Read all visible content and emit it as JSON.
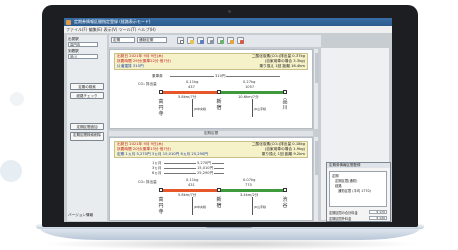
{
  "titlebar": {
    "title": "定期券情報区間指定登録 (経路表示モード)"
  },
  "menubar": {
    "text": "ファイル(F)  編集(E)  表示(V)  ツール(T)  ヘルプ(H)"
  },
  "left_panel": {
    "label1": "出発駅",
    "field1": "高円寺",
    "label2": "到着駅",
    "field2": "品川",
    "button1": "定期の検索",
    "button2": "経路チェック",
    "button3": "定期区間追加",
    "button4": "定期区間検索削除",
    "footer": "バージョン情報"
  },
  "toolbar": {
    "select1": "定期",
    "select2": "通勤定期"
  },
  "upper": {
    "line1_left": "出発日   2021年 9月 9日(木)",
    "line1_right": "二酸化炭素(CO₂)排出量  0.37kg",
    "line2_left": "所要時間 29分(乗車22分 他7分)",
    "line2_right": "(自家用車の場合 3.3kg)",
    "line3_left": "片道運賃 310円",
    "line3_right": "乗り換え 1回  距離 16.4km",
    "fare_label": "乗車券",
    "fare_value": "310円",
    "co2_label": "CO₂ 排出量",
    "co2_a_top": "0.11kg",
    "co2_a_bottom": "437",
    "co2_b_top": "0.27kg",
    "co2_b_bottom": "1057",
    "seg1_label": "5.8km/7分",
    "seg2_label": "10.6km/7分",
    "stations": [
      "高円寺",
      "新宿",
      "品川"
    ],
    "lines": [
      "JR中央線",
      "JR山手線"
    ]
  },
  "separator_label": "定期区間",
  "lower": {
    "line1_left": "出発日   2021年 9月 9日(木)",
    "line1_right": "二酸化炭素(CO₂)排出量  0.18kg",
    "line2_left": "所要時間 20分(乗車13分 他7分)",
    "line2_right": "(自家用車の場合 1.9kg)",
    "line3_left": "定期 1ヵ月 5,270円  3ヵ月 15,010円  6ヵ月 25,290円",
    "line3_right": "乗り換え 1回  距離 9.2km",
    "periods": [
      {
        "label": "1ヵ月",
        "value": "5,270円"
      },
      {
        "label": "3ヵ月",
        "value": "15,010円"
      },
      {
        "label": "6ヵ月",
        "value": "25,290円"
      }
    ],
    "co2_label": "CO₂ 排出量",
    "co2_a_top": "0.11kg",
    "co2_a_bottom": "431",
    "co2_b_top": "0.07kg",
    "co2_b_bottom": "770",
    "seg1_label": "5.8km/7分",
    "seg2_label": "3.4km/2分",
    "stations": [
      "高円寺",
      "新宿",
      "渋谷"
    ],
    "lines": [
      "JR中央線",
      "JR山手線"
    ]
  },
  "dialog": {
    "title": "定期券情報区間登録",
    "tree": [
      "定期",
      "定期区間(通勤)",
      "経路",
      "通勤区間 (平均 1770)"
    ],
    "row1_label": "定期区間の合計料金",
    "row1_value": "¥ 170",
    "row2_label": "定期区間外料金",
    "row2_value": "¥ 140"
  },
  "colors": {
    "seg1": "#e8572a",
    "seg2": "#3e9a3c",
    "info_bg": "#f5f1c8",
    "highlight": "#c41818"
  }
}
